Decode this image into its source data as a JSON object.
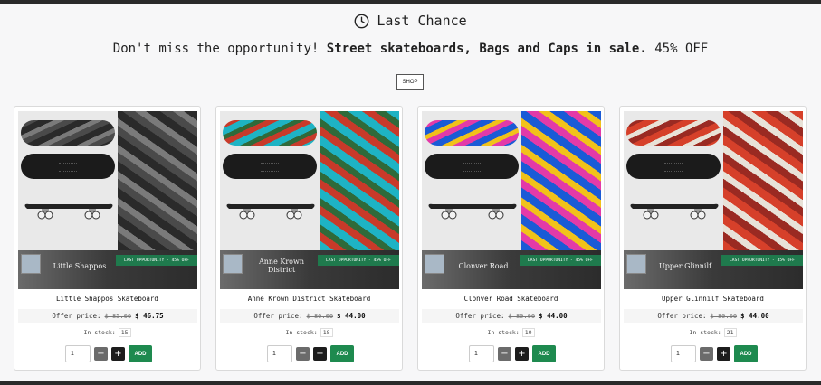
{
  "header": {
    "title": "Last Chance",
    "tagline_prefix": "Don't miss the opportunity! ",
    "tagline_bold": "Street skateboards, Bags and Caps in sale.",
    "tagline_suffix": " 45% OFF",
    "shop_label": "SHOP"
  },
  "labels": {
    "offer_price": "Offer price:",
    "in_stock": "In stock:",
    "add": "ADD",
    "minus": "−",
    "plus": "+"
  },
  "products": [
    {
      "title": "Little Shappos Skateboard",
      "brand": "Little Shappos",
      "ribbon": "LAST OPPORTUNITY - 45% OFF",
      "old_price": "$ 85.00",
      "new_price": "$ 46.75",
      "stock": "15",
      "qty": "1",
      "colors": [
        "#2a2a2a",
        "#4a4a4a",
        "#7a7a7a"
      ]
    },
    {
      "title": "Anne Krown District Skateboard",
      "brand": "Anne Krown District",
      "ribbon": "LAST OPPORTUNITY - 45% OFF",
      "old_price": "$ 80.00",
      "new_price": "$ 44.00",
      "stock": "18",
      "qty": "1",
      "colors": [
        "#1eb3c4",
        "#c83a2a",
        "#2f6a3a"
      ]
    },
    {
      "title": "Clonver Road Skateboard",
      "brand": "Clonver Road",
      "ribbon": "LAST OPPORTUNITY - 45% OFF",
      "old_price": "$ 80.00",
      "new_price": "$ 44.00",
      "stock": "10",
      "qty": "1",
      "colors": [
        "#1a5bd6",
        "#e33aa8",
        "#f1c21a"
      ]
    },
    {
      "title": "Upper Glinnilf Skateboard",
      "brand": "Upper Glinnilf",
      "ribbon": "LAST OPPORTUNITY - 45% OFF",
      "old_price": "$ 80.00",
      "new_price": "$ 44.00",
      "stock": "21",
      "qty": "1",
      "colors": [
        "#d6402a",
        "#9a2a22",
        "#e8e2d8"
      ]
    }
  ]
}
